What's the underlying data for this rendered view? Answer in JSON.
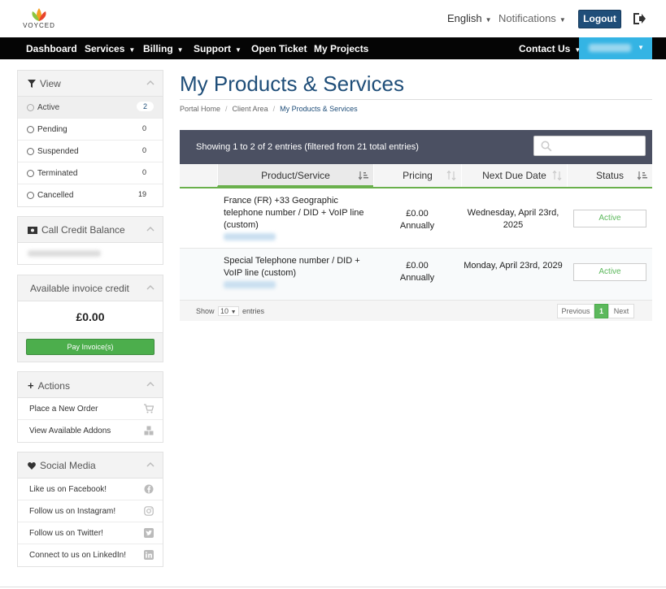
{
  "brand": {
    "logo_text": "VOYCED"
  },
  "topbar": {
    "language": "English",
    "notifications": "Notifications",
    "logout": "Logout"
  },
  "nav": {
    "items": [
      "Dashboard",
      "Services",
      "Billing",
      "Support",
      "Open Ticket",
      "My Projects"
    ],
    "contact": "Contact Us"
  },
  "sidebar": {
    "view": {
      "title": "View",
      "items": [
        {
          "label": "Active",
          "count": "2"
        },
        {
          "label": "Pending",
          "count": "0"
        },
        {
          "label": "Suspended",
          "count": "0"
        },
        {
          "label": "Terminated",
          "count": "0"
        },
        {
          "label": "Cancelled",
          "count": "19"
        }
      ]
    },
    "call_credit": {
      "title": "Call Credit Balance"
    },
    "invoice_credit": {
      "title": "Available invoice credit",
      "amount": "£0.00",
      "pay_button": "Pay Invoice(s)"
    },
    "actions": {
      "title": "Actions",
      "items": [
        "Place a New Order",
        "View Available Addons"
      ]
    },
    "social": {
      "title": "Social Media",
      "items": [
        "Like us on Facebook!",
        "Follow us on Instagram!",
        "Follow us on Twitter!",
        "Connect to us on LinkedIn!"
      ]
    }
  },
  "main": {
    "title": "My Products & Services",
    "breadcrumb": [
      "Portal Home",
      "Client Area",
      "My Products & Services"
    ],
    "showing": "Showing 1 to 2 of 2 entries (filtered from 21 total entries)",
    "search_placeholder": "",
    "columns": [
      "Product/Service",
      "Pricing",
      "Next Due Date",
      "Status"
    ],
    "rows": [
      {
        "product": "France (FR) +33 Geographic telephone number / DID + VoIP line (custom)",
        "price": "£0.00",
        "cycle": "Annually",
        "due": "Wednesday, April 23rd, 2025",
        "status": "Active"
      },
      {
        "product": "Special Telephone number / DID + VoIP line (custom)",
        "price": "£0.00",
        "cycle": "Annually",
        "due": "Monday, April 23rd, 2029",
        "status": "Active"
      }
    ],
    "footer": {
      "show": "Show",
      "page_size": "10",
      "entries": "entries",
      "previous": "Previous",
      "page": "1",
      "next": "Next"
    }
  },
  "colors": {
    "primary": "#1f4e79",
    "nav_bg": "#050505",
    "accent_blue": "#34b4e4",
    "success": "#5cb85c",
    "table_header": "#4b5062"
  }
}
